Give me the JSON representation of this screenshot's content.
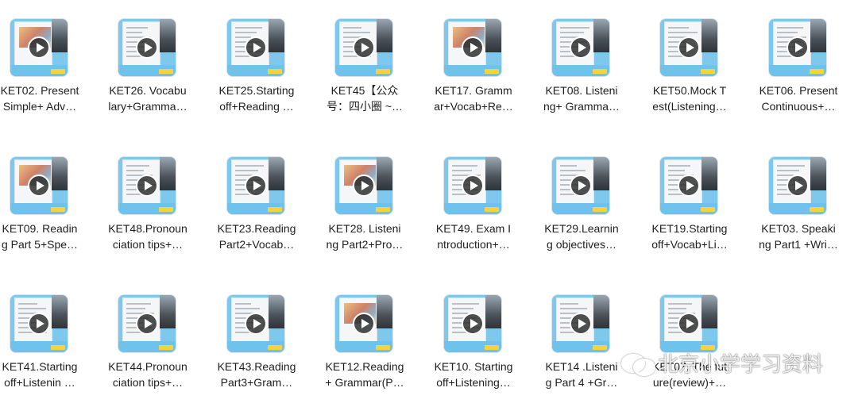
{
  "items": [
    {
      "line1": "KET02. Present",
      "line2": "Simple+ Adv…"
    },
    {
      "line1": "KET26. Vocabu",
      "line2": "lary+Gramma…"
    },
    {
      "line1": "KET25.Starting",
      "line2": "off+Reading …"
    },
    {
      "line1": "KET45【公众",
      "line2": "号：四小圈 ~…"
    },
    {
      "line1": "KET17. Gramm",
      "line2": "ar+Vocab+Re…"
    },
    {
      "line1": "KET08. Listeni",
      "line2": "ng+ Gramma…"
    },
    {
      "line1": "KET50.Mock T",
      "line2": "est(Listening…"
    },
    {
      "line1": "KET06. Present",
      "line2": "Continuous+…"
    },
    {
      "line1": "KET09. Readin",
      "line2": "g Part 5+Spe…"
    },
    {
      "line1": "KET48.Pronoun",
      "line2": "ciation tips+…"
    },
    {
      "line1": "KET23.Reading",
      "line2": "Part2+Vocab…"
    },
    {
      "line1": "KET28. Listeni",
      "line2": "ng Part2+Pro…"
    },
    {
      "line1": "KET49. Exam I",
      "line2": "ntroduction+…"
    },
    {
      "line1": "KET29.Learnin",
      "line2": "g objectives…"
    },
    {
      "line1": "KET19.Starting",
      "line2": "off+Vocab+Li…"
    },
    {
      "line1": "KET03. Speaki",
      "line2": "ng Part1 +Wri…"
    },
    {
      "line1": "KET41.Starting",
      "line2": "off+Listenin …"
    },
    {
      "line1": "KET44.Pronoun",
      "line2": "ciation tips+…"
    },
    {
      "line1": "KET43.Reading",
      "line2": "Part3+Gram…"
    },
    {
      "line1": "KET12.Reading",
      "line2": "+ Grammar(P…"
    },
    {
      "line1": "KET10. Starting",
      "line2": "off+Listening…"
    },
    {
      "line1": "KET14 .Listeni",
      "line2": "g Part 4 +Gr…"
    },
    {
      "line1": "KET07. The fut",
      "line2": "ure(review)+…"
    }
  ],
  "watermark": {
    "text": "北京小学学习资料",
    "icon": "wechat-icon"
  }
}
